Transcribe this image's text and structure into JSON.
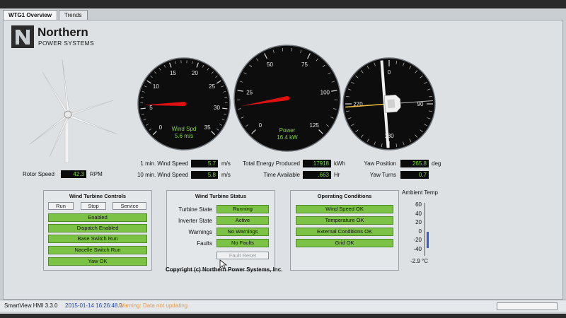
{
  "tabs": [
    {
      "label": "WTG1 Overview"
    },
    {
      "label": "Trends"
    }
  ],
  "logo": {
    "line1": "Northern",
    "line2": "POWER SYSTEMS"
  },
  "gauges": {
    "wind": {
      "ticks": [
        "0",
        "5",
        "10",
        "15",
        "20",
        "25",
        "30",
        "35"
      ],
      "label": "Wind Spd",
      "value_text": "5.6 m/s",
      "value": 5.6
    },
    "power": {
      "ticks": [
        "0",
        "25",
        "50",
        "75",
        "100",
        "125"
      ],
      "label": "Power",
      "value_text": "16.4 kW",
      "value": 16.4
    },
    "yaw": {
      "ticks": [
        "0",
        "90",
        "180",
        "270"
      ],
      "value": 265.8
    }
  },
  "readouts": {
    "rotor_speed": {
      "label": "Rotor Speed",
      "value": "42.3",
      "unit": "RPM"
    },
    "wind_1min": {
      "label": "1 min. Wind Speed",
      "value": "5.7",
      "unit": "m/s"
    },
    "wind_10min": {
      "label": "10 min. Wind Speed",
      "value": "5.8",
      "unit": "m/s"
    },
    "energy": {
      "label": "Total Energy Produced",
      "value": "17918",
      "unit": "kWh"
    },
    "time_avail": {
      "label": "Time Available",
      "value": ".663",
      "unit": "Hr"
    },
    "yaw_pos": {
      "label": "Yaw Position",
      "value": "265.8",
      "unit": "deg"
    },
    "yaw_turns": {
      "label": "Yaw Turns",
      "value": "0.7"
    }
  },
  "controls": {
    "title": "Wind Turbine Controls",
    "run": "Run",
    "stop": "Stop",
    "service": "Service",
    "items": [
      "Enabled",
      "Dispatch Enabled",
      "Base Switch Run",
      "Nacelle Switch Run",
      "Yaw OK"
    ]
  },
  "turbine_status": {
    "title": "Wind Turbine Status",
    "rows": [
      {
        "label": "Turbine State",
        "value": "Running"
      },
      {
        "label": "Inverter State",
        "value": "Active"
      },
      {
        "label": "Warnings",
        "value": "No Warnings"
      },
      {
        "label": "Faults",
        "value": "No Faults"
      }
    ],
    "fault_reset": "Fault Reset"
  },
  "operating": {
    "title": "Operating Conditions",
    "items": [
      "Wind Speed OK",
      "Temperature OK",
      "External Conditions OK",
      "Grid OK"
    ]
  },
  "ambient": {
    "title": "Ambient Temp",
    "ticks": [
      "60",
      "40",
      "20",
      "0",
      "-20",
      "-40"
    ],
    "value_text": "-2.9 °C",
    "value": -2.9
  },
  "copyright": "Copyright (c)  Northern Power Systems, Inc.",
  "status": {
    "version": "SmartView HMI 3.3.0",
    "timestamp": "2015-01-14 16:26:48.0",
    "warning": "Warning: Data not updating"
  },
  "colors": {
    "green": "#7cc244",
    "needle": "#e01010",
    "readout": "#7ddc3c"
  }
}
